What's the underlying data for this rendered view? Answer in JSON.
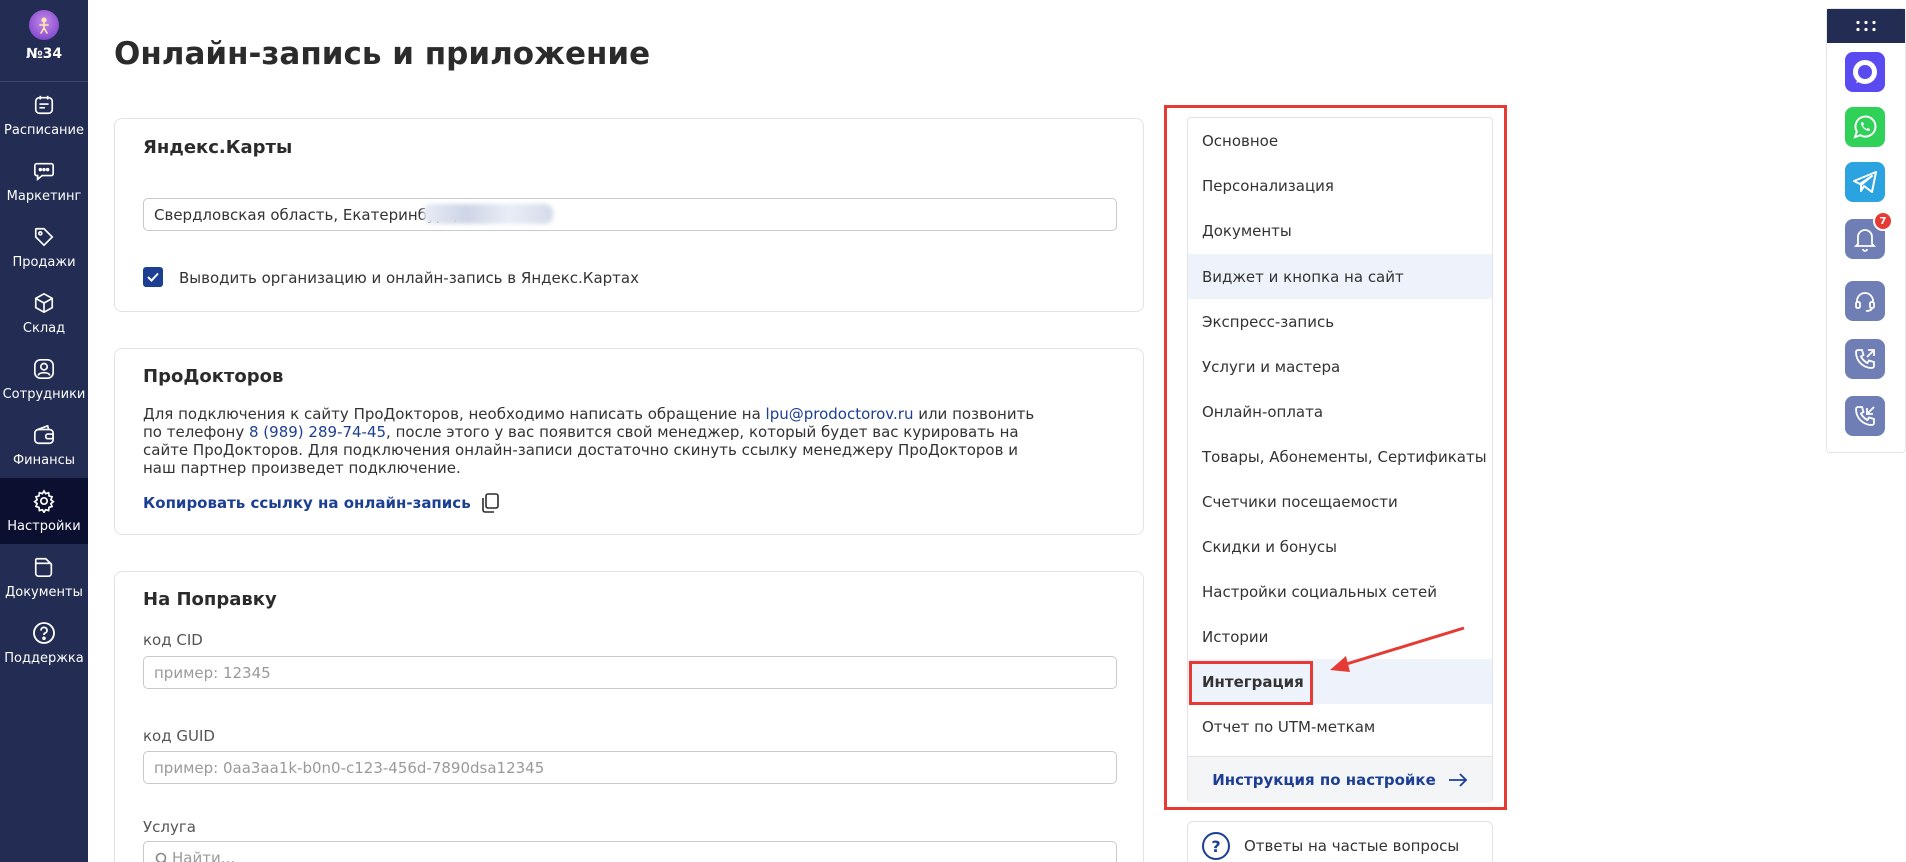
{
  "brand": {
    "label": "№34",
    "icon": "user-avatar-icon"
  },
  "sidebar": {
    "items": [
      {
        "label": "Расписание",
        "icon": "calendar-icon"
      },
      {
        "label": "Маркетинг",
        "icon": "chat-icon"
      },
      {
        "label": "Продажи",
        "icon": "tag-icon"
      },
      {
        "label": "Склад",
        "icon": "box-icon"
      },
      {
        "label": "Сотрудники",
        "icon": "user-icon"
      },
      {
        "label": "Финансы",
        "icon": "wallet-icon"
      },
      {
        "label": "Настройки",
        "icon": "gear-icon",
        "active": true
      },
      {
        "label": "Документы",
        "icon": "folder-icon"
      },
      {
        "label": "Поддержка",
        "icon": "help-icon"
      }
    ]
  },
  "page": {
    "title": "Онлайн-запись и приложение"
  },
  "yandex": {
    "title": "Яндекс.Карты",
    "address_value": "Свердловская область, Екатеринбург,",
    "checkbox_label": "Выводить организацию и онлайн-запись в Яндекс.Картах",
    "checkbox_checked": true
  },
  "prodoctorov": {
    "title": "ПроДокторов",
    "text_1": "Для подключения к сайту ПроДокторов, необходимо написать обращение на ",
    "email": "lpu@prodoctorov.ru",
    "text_2": " или позвонить по телефону ",
    "phone": "8 (989) 289-74-45",
    "text_3": ", после этого у вас появится свой менеджер, который будет вас курировать на сайте ПроДокторов. Для подключения онлайн-записи достаточно скинуть ссылку менеджеру ПроДокторов и наш партнер произведет подключение.",
    "copy_label": "Копировать ссылку на онлайн-запись"
  },
  "napopravku": {
    "title": "На Поправку",
    "cid_label": "код CID",
    "cid_placeholder": "пример: 12345",
    "guid_label": "код GUID",
    "guid_placeholder": "пример: 0aa3aa1k-b0n0-c123-456d-7890dsa12345",
    "service_label": "Услуга",
    "service_placeholder": "Найти..."
  },
  "settings_menu": {
    "items": [
      {
        "label": "Основное"
      },
      {
        "label": "Персонализация"
      },
      {
        "label": "Документы"
      },
      {
        "label": "Виджет и кнопка на сайт",
        "hover": true
      },
      {
        "label": "Экспресс-запись"
      },
      {
        "label": "Услуги и мастера"
      },
      {
        "label": "Онлайн-оплата"
      },
      {
        "label": "Товары, Абонементы, Сертификаты"
      },
      {
        "label": "Счетчики посещаемости"
      },
      {
        "label": "Скидки и бонусы"
      },
      {
        "label": "Настройки социальных сетей"
      },
      {
        "label": "Истории"
      },
      {
        "label": "Интеграция",
        "active": true
      },
      {
        "label": "Отчет по UTM-меткам"
      }
    ],
    "footer_label": "Инструкция по настройке"
  },
  "faq": {
    "label": "Ответы на частые вопросы"
  },
  "widgets": {
    "notifications_count": "7",
    "icons": [
      "apps-grid-icon",
      "messenger-icon",
      "whatsapp-icon",
      "telegram-icon",
      "bell-icon",
      "headset-icon",
      "phone-outgoing-icon",
      "phone-incoming-icon"
    ]
  },
  "colors": {
    "sidebar": "#232c52",
    "accent": "#1c3f94",
    "highlight": "#e53b34"
  }
}
